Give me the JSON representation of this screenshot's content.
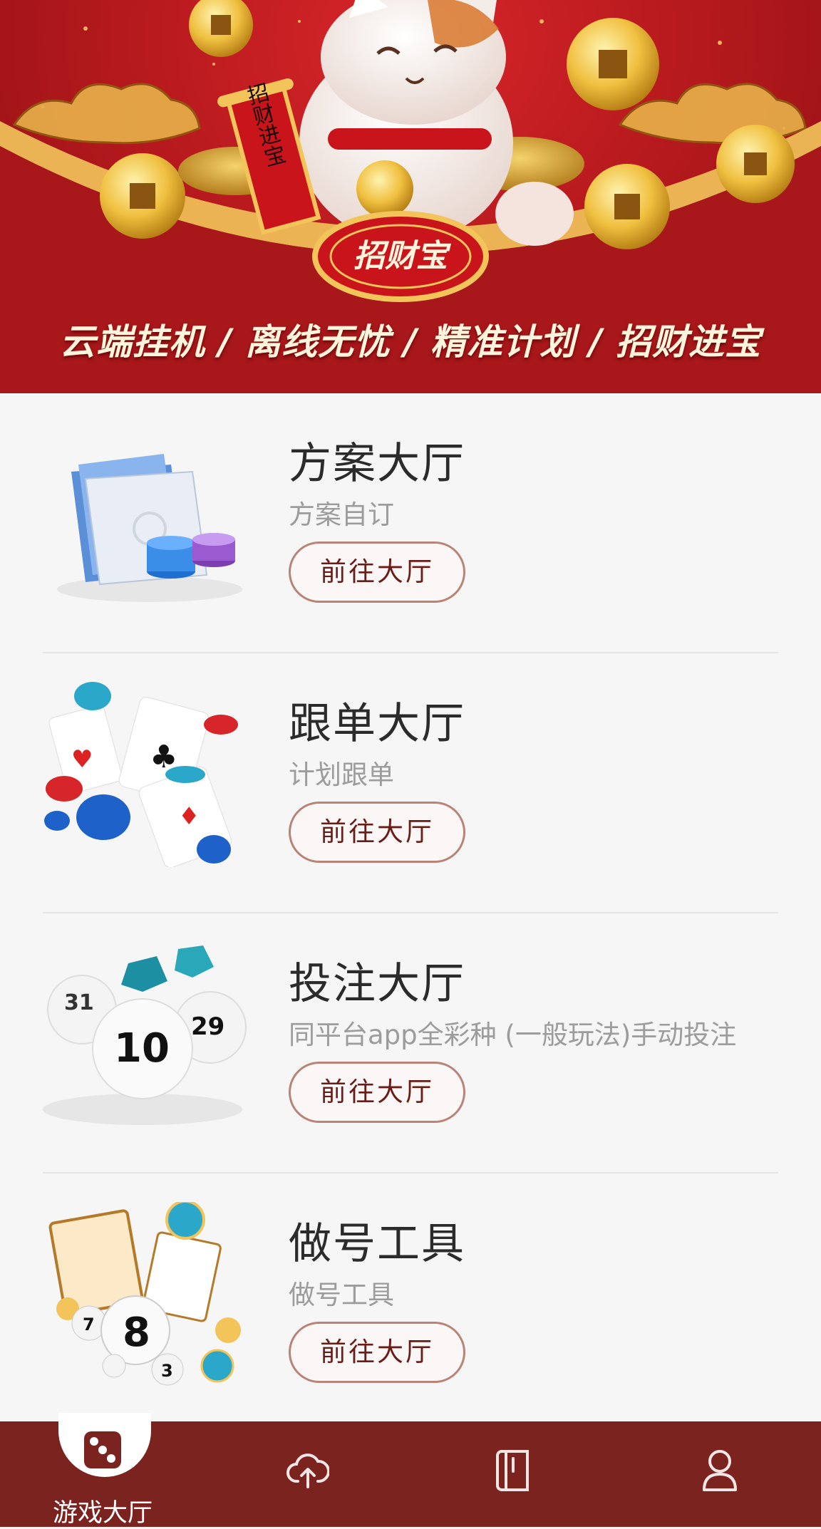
{
  "banner": {
    "slogan": "云端挂机 / 离线无忧 / 精准计划 / 招财进宝",
    "logo_text": "招财宝",
    "scroll_text": "招财进宝"
  },
  "cards": [
    {
      "title": "方案大厅",
      "subtitle": "方案自订",
      "button": "前往大厅",
      "icon": "folder-chips-icon"
    },
    {
      "title": "跟单大厅",
      "subtitle": "计划跟单",
      "button": "前往大厅",
      "icon": "playing-cards-chips-icon"
    },
    {
      "title": "投注大厅",
      "subtitle": "同平台app全彩种 (一般玩法)手动投注",
      "button": "前往大厅",
      "icon": "lottery-balls-icon"
    },
    {
      "title": "做号工具",
      "subtitle": "做号工具",
      "button": "前往大厅",
      "icon": "casino-collage-icon"
    }
  ],
  "tabbar": {
    "tabs": [
      {
        "label": "游戏大厅",
        "icon": "dice-icon",
        "active": true
      },
      {
        "label": "",
        "icon": "cloud-upload-icon"
      },
      {
        "label": "",
        "icon": "notebook-icon"
      },
      {
        "label": "",
        "icon": "user-icon"
      }
    ]
  },
  "colors": {
    "accent": "#7b231f",
    "button_border": "#b98478",
    "button_text": "#6a1d17"
  }
}
